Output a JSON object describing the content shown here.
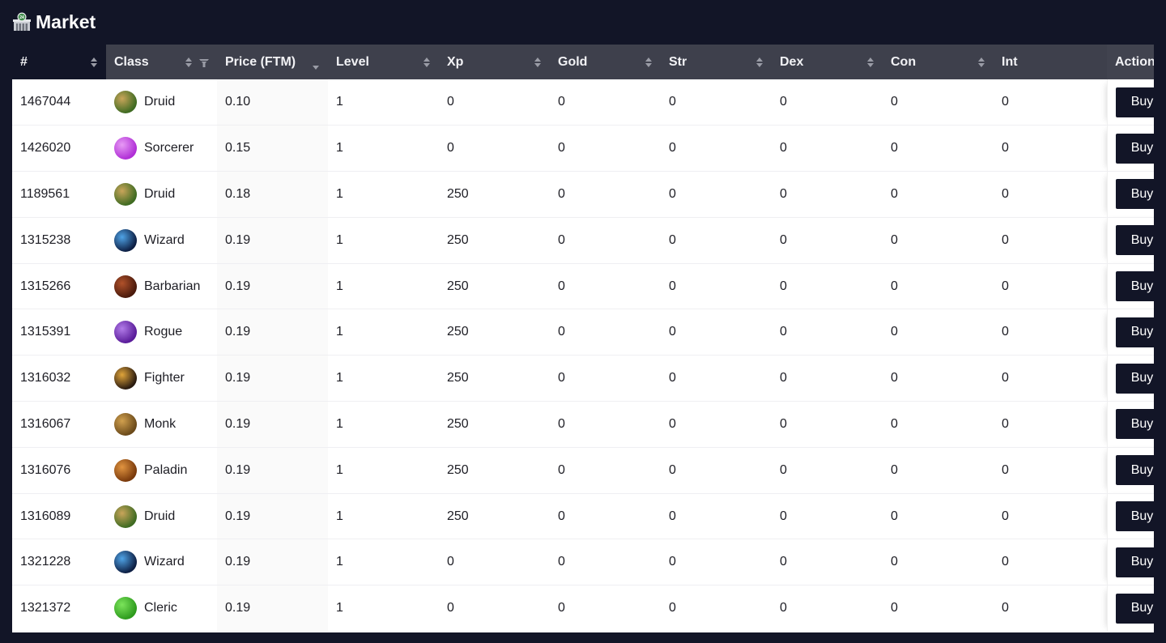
{
  "header": {
    "icon": "convenience-store-icon",
    "title": "Market"
  },
  "table": {
    "columns": [
      {
        "key": "id",
        "label": "#",
        "sortable": true
      },
      {
        "key": "class",
        "label": "Class",
        "sortable": true,
        "filterable": true
      },
      {
        "key": "price",
        "label": "Price (FTM)",
        "sortable": true,
        "sort": "descending-indicator"
      },
      {
        "key": "level",
        "label": "Level",
        "sortable": true
      },
      {
        "key": "xp",
        "label": "Xp",
        "sortable": true
      },
      {
        "key": "gold",
        "label": "Gold",
        "sortable": true
      },
      {
        "key": "str",
        "label": "Str",
        "sortable": true
      },
      {
        "key": "dex",
        "label": "Dex",
        "sortable": true
      },
      {
        "key": "con",
        "label": "Con",
        "sortable": true
      },
      {
        "key": "int",
        "label": "Int",
        "sortable": false
      },
      {
        "key": "action",
        "label": "Action",
        "sortable": false
      }
    ],
    "buy_label": "Buy",
    "class_colors": {
      "Druid": [
        "#3f6b22",
        "#c9a55a"
      ],
      "Sorcerer": [
        "#b02fd6",
        "#e79af5"
      ],
      "Wizard": [
        "#0d1f44",
        "#4fa3e6"
      ],
      "Barbarian": [
        "#4a1a0c",
        "#b0512a"
      ],
      "Rogue": [
        "#5a1c9a",
        "#b17be8"
      ],
      "Fighter": [
        "#2a1b10",
        "#e0a43a"
      ],
      "Monk": [
        "#6b4a1b",
        "#d1a04e"
      ],
      "Paladin": [
        "#7a3a0c",
        "#e19440"
      ],
      "Cleric": [
        "#2e9b1e",
        "#7be45b"
      ]
    },
    "rows": [
      {
        "id": "1467044",
        "class": "Druid",
        "price": "0.10",
        "level": "1",
        "xp": "0",
        "gold": "0",
        "str": "0",
        "dex": "0",
        "con": "0",
        "int": "0"
      },
      {
        "id": "1426020",
        "class": "Sorcerer",
        "price": "0.15",
        "level": "1",
        "xp": "0",
        "gold": "0",
        "str": "0",
        "dex": "0",
        "con": "0",
        "int": "0"
      },
      {
        "id": "1189561",
        "class": "Druid",
        "price": "0.18",
        "level": "1",
        "xp": "250",
        "gold": "0",
        "str": "0",
        "dex": "0",
        "con": "0",
        "int": "0"
      },
      {
        "id": "1315238",
        "class": "Wizard",
        "price": "0.19",
        "level": "1",
        "xp": "250",
        "gold": "0",
        "str": "0",
        "dex": "0",
        "con": "0",
        "int": "0"
      },
      {
        "id": "1315266",
        "class": "Barbarian",
        "price": "0.19",
        "level": "1",
        "xp": "250",
        "gold": "0",
        "str": "0",
        "dex": "0",
        "con": "0",
        "int": "0"
      },
      {
        "id": "1315391",
        "class": "Rogue",
        "price": "0.19",
        "level": "1",
        "xp": "250",
        "gold": "0",
        "str": "0",
        "dex": "0",
        "con": "0",
        "int": "0"
      },
      {
        "id": "1316032",
        "class": "Fighter",
        "price": "0.19",
        "level": "1",
        "xp": "250",
        "gold": "0",
        "str": "0",
        "dex": "0",
        "con": "0",
        "int": "0"
      },
      {
        "id": "1316067",
        "class": "Monk",
        "price": "0.19",
        "level": "1",
        "xp": "250",
        "gold": "0",
        "str": "0",
        "dex": "0",
        "con": "0",
        "int": "0"
      },
      {
        "id": "1316076",
        "class": "Paladin",
        "price": "0.19",
        "level": "1",
        "xp": "250",
        "gold": "0",
        "str": "0",
        "dex": "0",
        "con": "0",
        "int": "0"
      },
      {
        "id": "1316089",
        "class": "Druid",
        "price": "0.19",
        "level": "1",
        "xp": "250",
        "gold": "0",
        "str": "0",
        "dex": "0",
        "con": "0",
        "int": "0"
      },
      {
        "id": "1321228",
        "class": "Wizard",
        "price": "0.19",
        "level": "1",
        "xp": "0",
        "gold": "0",
        "str": "0",
        "dex": "0",
        "con": "0",
        "int": "0"
      },
      {
        "id": "1321372",
        "class": "Cleric",
        "price": "0.19",
        "level": "1",
        "xp": "0",
        "gold": "0",
        "str": "0",
        "dex": "0",
        "con": "0",
        "int": "0"
      }
    ]
  }
}
